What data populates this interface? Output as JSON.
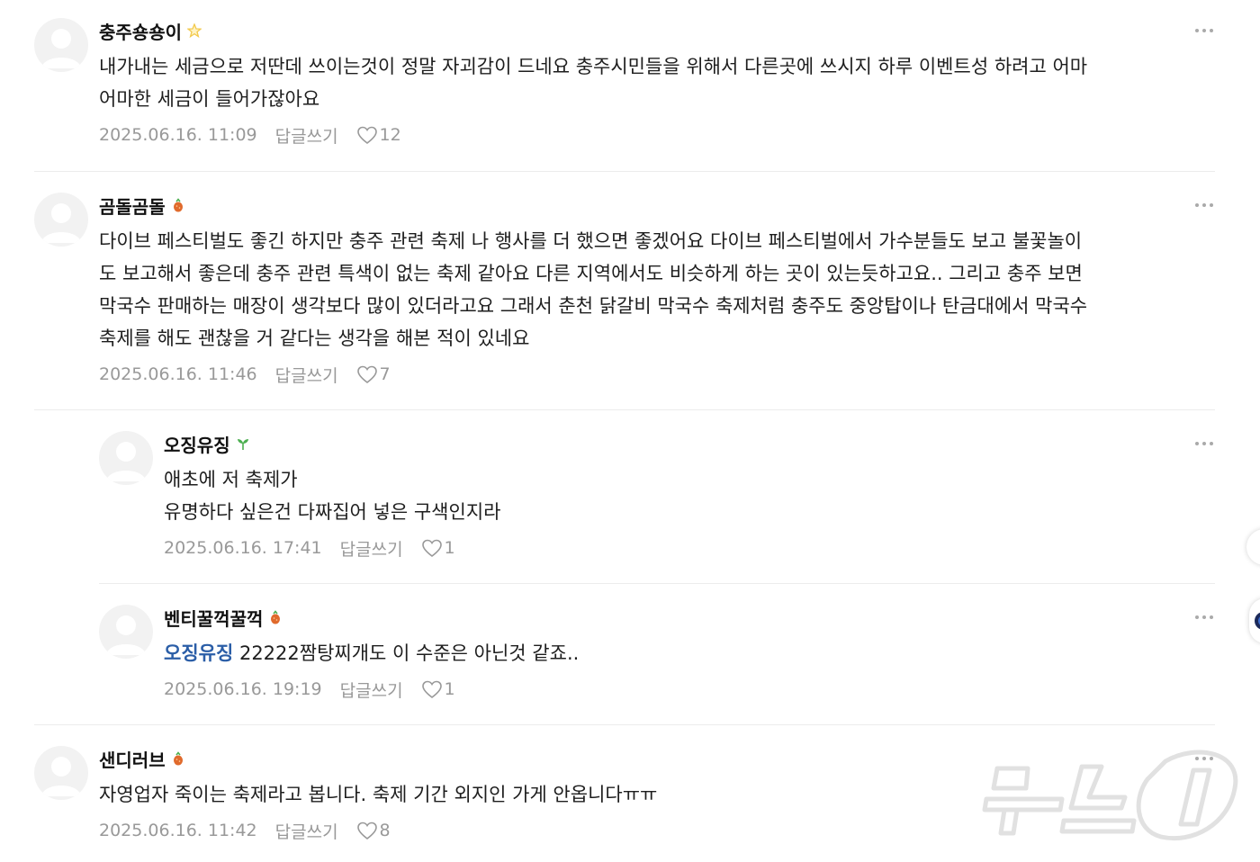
{
  "comments": [
    {
      "nickname": "충주숑숑이",
      "badge_icon": "star-icon",
      "text": "내가내는 세금으로 저딴데 쓰이는것이 정말 자괴감이 드네요 충주시민들을 위해서 다른곳에 쓰시지 하루 이벤트성 하려고 어마\n어마한 세금이 들어가잖아요",
      "time": "2025.06.16. 11:09",
      "reply_label": "답글쓰기",
      "likes": "12"
    },
    {
      "nickname": "곰돌곰돌",
      "badge_icon": "fruit-icon",
      "text": "다이브 페스티벌도 좋긴 하지만 충주 관련 축제 나 행사를 더 했으면 좋겠어요 다이브 페스티벌에서 가수분들도 보고 불꽃놀이\n도 보고해서 좋은데 충주 관련 특색이 없는 축제 같아요 다른 지역에서도 비슷하게 하는 곳이 있는듯하고요.. 그리고 충주 보면\n막국수 판매하는 매장이 생각보다 많이 있더라고요 그래서 춘천 닭갈비 막국수 축제처럼 충주도 중앙탑이나 탄금대에서 막국수\n축제를 해도 괜찮을 거 같다는 생각을 해본 적이 있네요",
      "time": "2025.06.16. 11:46",
      "reply_label": "답글쓰기",
      "likes": "7"
    },
    {
      "nickname": "오징유징",
      "badge_icon": "sprout-icon",
      "text": "애초에 저 축제가\n유명하다 싶은건 다짜집어 넣은 구색인지라",
      "time": "2025.06.16. 17:41",
      "reply_label": "답글쓰기",
      "likes": "1"
    },
    {
      "nickname": "벤티꿀꺽꿀꺽",
      "badge_icon": "fruit-icon",
      "mention": "오징유징",
      "text": " 22222짬탕찌개도 이 수준은 아닌것 같죠..",
      "time": "2025.06.16. 19:19",
      "reply_label": "답글쓰기",
      "likes": "1"
    },
    {
      "nickname": "샌디러브",
      "badge_icon": "fruit-icon",
      "text": "자영업자 죽이는 축제라고 봅니다. 축제 기간 외지인 가게 안옵니다ㅠㅠ",
      "time": "2025.06.16. 11:42",
      "reply_label": "답글쓰기",
      "likes": "8"
    }
  ],
  "watermark": "뉴스1",
  "colors": {
    "mention": "#2b5ea7",
    "meta": "#999999",
    "star": "#f2c94c",
    "fruit": "#e06a2c",
    "sprout": "#4caf50"
  }
}
